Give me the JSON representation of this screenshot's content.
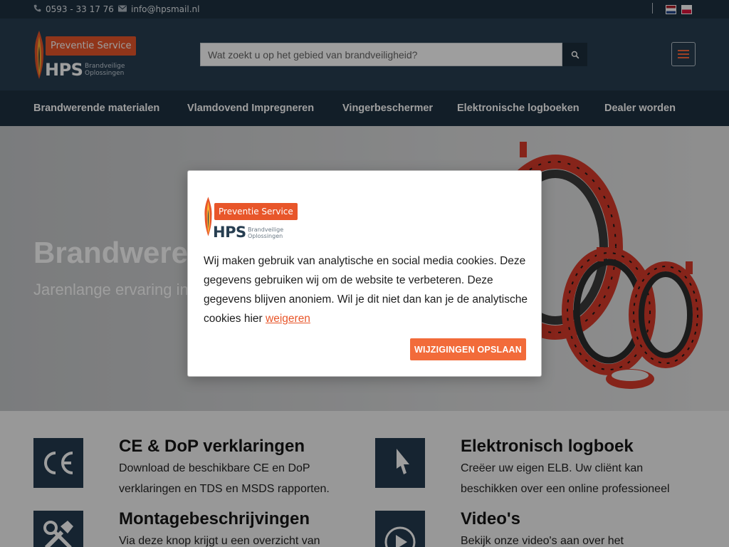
{
  "topbar": {
    "phone": "0593 - 33 17 76",
    "email": "info@hpsmail.nl",
    "phone_icon": "phone-icon",
    "email_icon": "envelope-icon"
  },
  "brand": {
    "badge": "Preventie Service",
    "name": "HPS",
    "tagline_line1": "Brandveilige",
    "tagline_line2": "Oplossingen"
  },
  "search": {
    "placeholder": "Wat zoekt u op het gebied van brandveiligheid?",
    "icon": "search-icon"
  },
  "nav": {
    "items": [
      {
        "label": "Brandwerende materialen"
      },
      {
        "label": "Vlamdovend Impregneren"
      },
      {
        "label": "Vingerbeschermer"
      },
      {
        "label": "Elektronische logboeken"
      },
      {
        "label": "Dealer worden"
      }
    ]
  },
  "hero": {
    "title": "Brandwerende",
    "subtitle": "Jarenlange ervaring in"
  },
  "features": [
    {
      "icon": "ce-mark-icon",
      "title": "CE & DoP verklaringen",
      "desc": "Download de beschikbare CE en DoP verklaringen en TDS en MSDS rapporten."
    },
    {
      "icon": "cursor-arrow-icon",
      "title": "Elektronisch logboek",
      "desc": "Creëer uw eigen ELB. Uw cliënt kan beschikken over een online professioneel"
    },
    {
      "icon": "tools-icon",
      "title": "Montagebeschrijvingen",
      "desc": "Via deze knop krijgt u een overzicht van"
    },
    {
      "icon": "play-icon",
      "title": "Video's",
      "desc": "Bekijk onze video's aan over het"
    }
  ],
  "modal": {
    "text": "Wij maken gebruik van analytische en social media cookies. Deze gegevens gebruiken wij om de website te verbeteren. Deze gegevens blijven anoniem. Wil je dit niet dan kan je de analytische cookies hier",
    "link": "weigeren",
    "button": "WIJZIGINGEN OPSLAAN"
  },
  "colors": {
    "navy": "#273e51",
    "accent": "#e8562a",
    "button": "#f26b3a"
  }
}
